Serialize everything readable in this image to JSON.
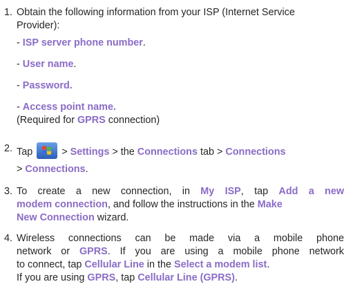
{
  "steps": [
    {
      "number": "1.",
      "text": "Obtain the following information from your ISP (Internet Service",
      "text2": "Provider):",
      "items": [
        {
          "prefix": "- ",
          "label": "ISP server phone number",
          "suffix": "."
        },
        {
          "prefix": "- ",
          "label": "User name",
          "suffix": "."
        },
        {
          "prefix": "- ",
          "label": "Password.",
          "suffix": ""
        },
        {
          "prefix": "- ",
          "label": "Access point name.",
          "suffix": ""
        }
      ],
      "note_pre": "(Required for ",
      "note_hl": "GPRS",
      "note_post": " connection)"
    },
    {
      "number": "2.",
      "tap": "Tap",
      "start_icon": "windows-start-icon",
      "sep1": " > ",
      "settings": "Settings",
      "sep2": " > the ",
      "connections_tab": "Connections",
      "sep3": " tab > ",
      "connections1": "Connections",
      "sep4": "> ",
      "connections2": "Connections",
      "end": "."
    },
    {
      "number": "3.",
      "p1": "To create a new connection, in ",
      "myisp": "My ISP",
      "p2": ", tap ",
      "add": "Add a new",
      "add2": "modem connection",
      "p3": ", and follow the instructions in the ",
      "make": "Make",
      "make2": "New Connection",
      "p4": " wizard."
    },
    {
      "number": "4.",
      "l1": "Wireless connections can be made via a mobile phone",
      "l2a": "network or ",
      "gprs": "GPRS",
      "l2b": ". If you are using a mobile phone network",
      "l3a": "to connect, tap ",
      "cellular": "Cellular Line",
      "l3b": " in the ",
      "select": "Select a modem list",
      "l3c": ".",
      "l4a": "If you are using ",
      "gprs2": "GPRS",
      "l4b": ", tap ",
      "cellular_gprs": "Cellular Line (GPRS)",
      "l4c": "."
    }
  ],
  "colors": {
    "text": "#262626",
    "highlight": "#8a6cc6"
  }
}
